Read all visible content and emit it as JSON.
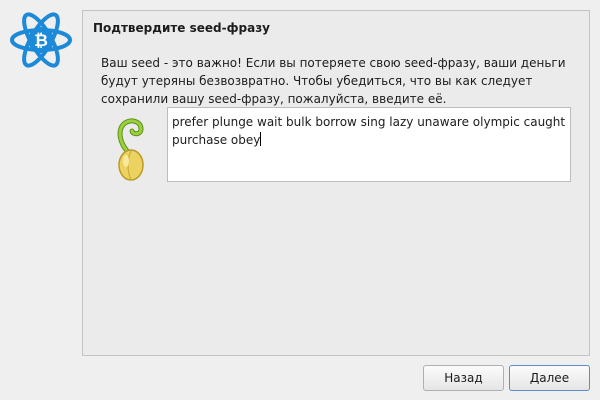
{
  "icons": {
    "app_logo": "electrum-bitcoin-logo",
    "seed": "seed-sprout-icon"
  },
  "colors": {
    "logo_blue": "#1c8ad8",
    "seed_yellow": "#ecd35f",
    "sprout_green": "#9ad13a",
    "default_button_border": "#5d8cc9"
  },
  "dialog": {
    "title": "Подтвердите seed-фразу",
    "message": "Ваш seed - это важно! Если вы потеряете свою seed-фразу, ваши деньги будут утеряны безвозвратно. Чтобы убедиться, что вы как следует сохранили вашу seed-фразу, пожалуйста, введите её.",
    "seed_input_value": "prefer plunge wait bulk borrow sing lazy unaware olympic caught purchase obey"
  },
  "buttons": {
    "back_label": "Назад",
    "next_label": "Далее"
  }
}
